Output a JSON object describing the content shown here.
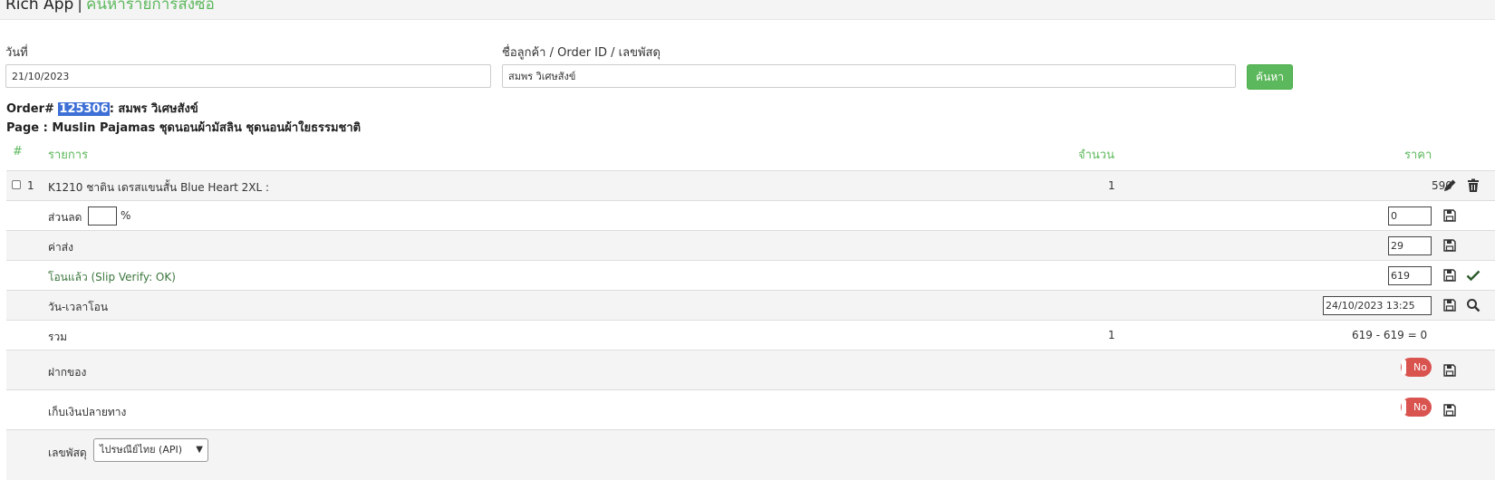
{
  "header": {
    "app_name": "Rich App",
    "separator": "|",
    "page_title": "ค้นหารายการสั่งซื้อ"
  },
  "search": {
    "date_label": "วันที่",
    "date_value": "21/10/2023",
    "customer_label": "ชื่อลูกค้า / Order ID / เลขพัสดุ",
    "customer_value": "สมพร วิเศษสังข์",
    "search_button": "ค้นหา"
  },
  "order": {
    "prefix": "Order#",
    "id": "125306",
    "customer": ": สมพร วิเศษสังข์",
    "page_line": "Page : Muslin Pajamas ชุดนอนผ้ามัสลิน ชุดนอนผ้าใยธรรมชาติ"
  },
  "table": {
    "headers": {
      "num": "#",
      "item": "รายการ",
      "qty": "จำนวน",
      "price": "ราคา"
    },
    "item": {
      "num": "1",
      "name": "K1210 ชาติน เดรสแขนสั้น Blue Heart 2XL :",
      "qty": "1",
      "price": "590"
    },
    "discount": {
      "label": "ส่วนลด",
      "percent_value": "",
      "unit": "%",
      "amount": "0"
    },
    "shipping": {
      "label": "ค่าส่ง",
      "amount": "29"
    },
    "transferred": {
      "label": "โอนแล้ว (Slip Verify: OK)",
      "amount": "619"
    },
    "transfer_time": {
      "label": "วัน-เวลาโอน",
      "value": "24/10/2023 13:25"
    },
    "total": {
      "label": "รวม",
      "qty": "1",
      "value": "619 - 619 = 0"
    },
    "deposit": {
      "label": "ฝากของ",
      "toggle": "No"
    },
    "cod": {
      "label": "เก็บเงินปลายทาง",
      "toggle": "No"
    },
    "tracking": {
      "label": "เลขพัสดุ",
      "carrier": "ไปรษณีย์ไทย (API)"
    }
  },
  "colors": {
    "accent": "#5cb85c",
    "danger": "#d9534f",
    "selection": "#3d6fd6"
  }
}
